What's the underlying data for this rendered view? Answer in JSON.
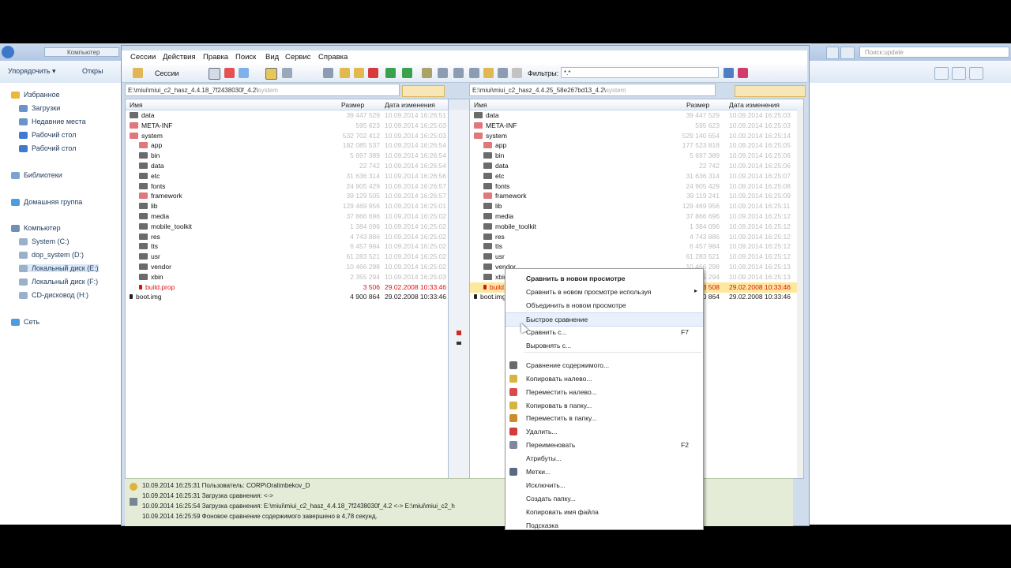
{
  "explorer": {
    "breadcrumb": "Компьютер",
    "search_placeholder": "Поиск:update",
    "organize_label": "Упорядочить ▾",
    "open_label": "Откры",
    "nav": [
      {
        "label": "Избранное",
        "color": "#e8b93a"
      },
      {
        "label": "Загрузки",
        "color": "#6a93c7"
      },
      {
        "label": "Недавние места",
        "color": "#6a93c7"
      },
      {
        "label": "Рабочий стол",
        "color": "#3e7bd0"
      },
      {
        "label": "Рабочий стол",
        "color": "#3e7bd0"
      },
      {
        "label": "Библиотеки",
        "color": "#7aa3d4"
      },
      {
        "label": "Домашняя группа",
        "color": "#4d9be0"
      },
      {
        "label": "Компьютер",
        "color": "#6f8fb6"
      },
      {
        "label": "System (C:)",
        "color": "#9bb0c9"
      },
      {
        "label": "dop_system (D:)",
        "color": "#9bb0c9"
      },
      {
        "label": "Локальный диск (E:)",
        "color": "#9bb0c9"
      },
      {
        "label": "Локальный диск (F:)",
        "color": "#9bb0c9"
      },
      {
        "label": "CD-дисковод (H:)",
        "color": "#9bb0c9"
      },
      {
        "label": "Сеть",
        "color": "#4d9be0"
      }
    ]
  },
  "bc": {
    "menu": [
      "Сессии",
      "Действия",
      "Правка",
      "Поиск",
      "Вид",
      "Сервис",
      "Справка"
    ],
    "toolbar": {
      "sessions": "Сессии",
      "filters_label": "Фильтры:",
      "filters_value": "*.*"
    },
    "left_path": {
      "main": "E:\\miui\\miui_c2_hasz_4.4.18_7f2438030f_4.2\\",
      "tail": "system"
    },
    "right_path": {
      "main": "E:\\miui\\miui_c2_hasz_4.4.25_58e267bd13_4.2\\",
      "tail": "system"
    },
    "columns": {
      "name": "Имя",
      "size": "Размер",
      "date": "Дата изменения"
    },
    "left_rows": [
      {
        "name": "data",
        "size": "39 447 529",
        "date": "10.09.2014 16:26:51",
        "indent": 0,
        "color": "grey"
      },
      {
        "name": "META-INF",
        "size": "595 623",
        "date": "10.09.2014 16:25:03",
        "indent": 0,
        "color": "red"
      },
      {
        "name": "system",
        "size": "532 702 412",
        "date": "10.09.2014 16:25:03",
        "indent": 0,
        "color": "red"
      },
      {
        "name": "app",
        "size": "182 085 537",
        "date": "10.09.2014 16:26:54",
        "indent": 1,
        "color": "red"
      },
      {
        "name": "bin",
        "size": "5 697 389",
        "date": "10.09.2014 16:26:54",
        "indent": 1,
        "color": "grey"
      },
      {
        "name": "data",
        "size": "22 742",
        "date": "10.09.2014 16:26:54",
        "indent": 1,
        "color": "grey"
      },
      {
        "name": "etc",
        "size": "31 636 314",
        "date": "10.09.2014 16:26:56",
        "indent": 1,
        "color": "grey"
      },
      {
        "name": "fonts",
        "size": "24 905 429",
        "date": "10.09.2014 16:26:57",
        "indent": 1,
        "color": "grey"
      },
      {
        "name": "framework",
        "size": "39 129 505",
        "date": "10.09.2014 16:26:57",
        "indent": 1,
        "color": "red"
      },
      {
        "name": "lib",
        "size": "129 469 956",
        "date": "10.09.2014 16:25:01",
        "indent": 1,
        "color": "grey"
      },
      {
        "name": "media",
        "size": "37 866 696",
        "date": "10.09.2014 16:25:02",
        "indent": 1,
        "color": "grey"
      },
      {
        "name": "mobile_toolkit",
        "size": "1 384 096",
        "date": "10.09.2014 16:25:02",
        "indent": 1,
        "color": "grey"
      },
      {
        "name": "res",
        "size": "4 743 886",
        "date": "10.09.2014 16:25:02",
        "indent": 1,
        "color": "grey"
      },
      {
        "name": "tts",
        "size": "6 457 984",
        "date": "10.09.2014 16:25:02",
        "indent": 1,
        "color": "grey"
      },
      {
        "name": "usr",
        "size": "61 283 521",
        "date": "10.09.2014 16:25:02",
        "indent": 1,
        "color": "grey"
      },
      {
        "name": "vendor",
        "size": "10 466 298",
        "date": "10.09.2014 16:25:02",
        "indent": 1,
        "color": "grey"
      },
      {
        "name": "xbin",
        "size": "2 355 294",
        "date": "10.09.2014 16:25:03",
        "indent": 1,
        "color": "grey"
      },
      {
        "name": "build.prop",
        "size": "3 506",
        "date": "29.02.2008 10:33:46",
        "indent": 1,
        "color": "file",
        "diff": true
      },
      {
        "name": "boot.img",
        "size": "4 900 864",
        "date": "29.02.2008 10:33:46",
        "indent": 0,
        "color": "file",
        "dark": true
      }
    ],
    "right_rows": [
      {
        "name": "data",
        "size": "39 447 529",
        "date": "10.09.2014 16:25:03",
        "indent": 0,
        "color": "grey"
      },
      {
        "name": "META-INF",
        "size": "595 623",
        "date": "10.09.2014 16:25:03",
        "indent": 0,
        "color": "red"
      },
      {
        "name": "system",
        "size": "529 140 654",
        "date": "10.09.2014 16:25:14",
        "indent": 0,
        "color": "red"
      },
      {
        "name": "app",
        "size": "177 523 818",
        "date": "10.09.2014 16:25:05",
        "indent": 1,
        "color": "red"
      },
      {
        "name": "bin",
        "size": "5 697 389",
        "date": "10.09.2014 16:25:06",
        "indent": 1,
        "color": "grey"
      },
      {
        "name": "data",
        "size": "22 742",
        "date": "10.09.2014 16:25:06",
        "indent": 1,
        "color": "grey"
      },
      {
        "name": "etc",
        "size": "31 636 314",
        "date": "10.09.2014 16:25:07",
        "indent": 1,
        "color": "grey"
      },
      {
        "name": "fonts",
        "size": "24 905 429",
        "date": "10.09.2014 16:25:08",
        "indent": 1,
        "color": "grey"
      },
      {
        "name": "framework",
        "size": "39 119 241",
        "date": "10.09.2014 16:25:09",
        "indent": 1,
        "color": "red"
      },
      {
        "name": "lib",
        "size": "129 469 956",
        "date": "10.09.2014 16:25:11",
        "indent": 1,
        "color": "grey"
      },
      {
        "name": "media",
        "size": "37 866 696",
        "date": "10.09.2014 16:25:12",
        "indent": 1,
        "color": "grey"
      },
      {
        "name": "mobile_toolkit",
        "size": "1 384 096",
        "date": "10.09.2014 16:25:12",
        "indent": 1,
        "color": "grey"
      },
      {
        "name": "res",
        "size": "4 743 886",
        "date": "10.09.2014 16:25:12",
        "indent": 1,
        "color": "grey"
      },
      {
        "name": "tts",
        "size": "6 457 984",
        "date": "10.09.2014 16:25:12",
        "indent": 1,
        "color": "grey"
      },
      {
        "name": "usr",
        "size": "61 283 521",
        "date": "10.09.2014 16:25:12",
        "indent": 1,
        "color": "grey"
      },
      {
        "name": "vendor",
        "size": "10 466 298",
        "date": "10.09.2014 16:25:13",
        "indent": 1,
        "color": "grey"
      },
      {
        "name": "xbin",
        "size": "2 355 294",
        "date": "10.09.2014 16:25:13",
        "indent": 1,
        "color": "grey"
      },
      {
        "name": "build.prop",
        "size": "3 508",
        "date": "29.02.2008 10:33:46",
        "indent": 1,
        "color": "file",
        "diff": true,
        "hl": true
      },
      {
        "name": "boot.img",
        "size": "4 900 864",
        "date": "29.02.2008 10:33:46",
        "indent": 0,
        "color": "file",
        "dark": true
      }
    ],
    "log": [
      "10.09.2014 16:25:31  Пользователь: CORP\\Oralimbekov_D",
      "10.09.2014 16:25:31  Загрузка сравнения: <->",
      "10.09.2014 16:25:54  Загрузка сравнения: E:\\miui\\miui_c2_hasz_4.4.18_7f2438030f_4.2 <-> E:\\miui\\miui_c2_h",
      "10.09.2014 16:25:59  Фоновое сравнение содержимого завершено в 4,78 секунд."
    ]
  },
  "context_menu": [
    {
      "label": "Сравнить в новом просмотре",
      "bold": true
    },
    {
      "label": "Сравнить в новом просмотре используя",
      "submenu": true
    },
    {
      "label": "Объединить в новом просмотре"
    },
    {
      "label": "Быстрое сравнение",
      "hover": true
    },
    {
      "label": "Сравнить с...",
      "shortcut": "F7"
    },
    {
      "label": "Выровнять с..."
    },
    {
      "label": "Сравнение содержимого...",
      "icon": "#6a6a6a"
    },
    {
      "label": "Копировать налево...",
      "icon": "#d7b341"
    },
    {
      "label": "Переместить налево...",
      "icon": "#d94b4b"
    },
    {
      "label": "Копировать в папку...",
      "icon": "#d7b341"
    },
    {
      "label": "Переместить в папку...",
      "icon": "#c98d2b"
    },
    {
      "label": "Удалить...",
      "icon": "#d63a3a"
    },
    {
      "label": "Переименовать",
      "shortcut": "F2",
      "icon": "#7d8a99"
    },
    {
      "label": "Атрибуты..."
    },
    {
      "label": "Метки...",
      "icon": "#5a6a80"
    },
    {
      "label": "Исключить..."
    },
    {
      "label": "Создать папку..."
    },
    {
      "label": "Копировать имя файла"
    },
    {
      "label": "Подсказка"
    }
  ]
}
